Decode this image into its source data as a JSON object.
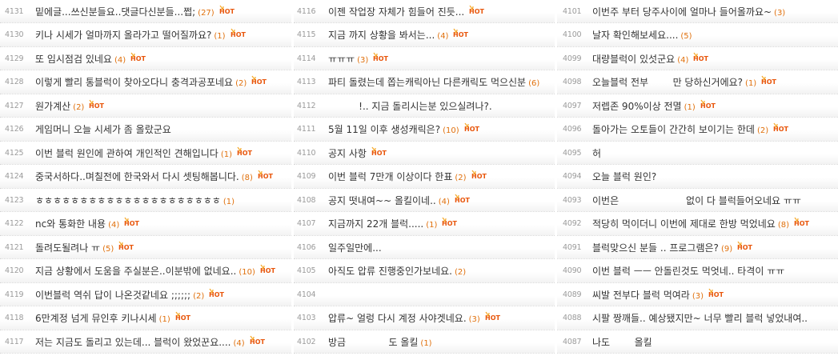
{
  "columns": [
    {
      "rows": [
        {
          "num": "4131",
          "title": "밑에글...쓰신분들요..댓글다신분들...쩝;",
          "count": "(27)",
          "hot": true
        },
        {
          "num": "4130",
          "title": "키나 시세가 얼마까지 올라가고 떨어질까요?",
          "count": "(1)",
          "hot": true
        },
        {
          "num": "4129",
          "title": "또 임시점검 있네요",
          "count": "(4)",
          "hot": true
        },
        {
          "num": "4128",
          "title": "이렇게 빨리 통블럭이 찾아오다니 충격과공포네요",
          "count": "(2)",
          "hot": true
        },
        {
          "num": "4127",
          "title": "원가계산",
          "count": "(2)",
          "hot": true
        },
        {
          "num": "4126",
          "title": "게임머니 오늘 시세가 좀 올랐군요",
          "count": "",
          "hot": false
        },
        {
          "num": "4125",
          "title": "이번 블럭 원인에 관하여 개인적인 견해입니다",
          "count": "(1)",
          "hot": true
        },
        {
          "num": "4124",
          "title": "중국서하다..며칠전에 한국와서 다시 셋팅해봅니다.",
          "count": "(8)",
          "hot": true
        },
        {
          "num": "4123",
          "title": "ㅎㅎㅎㅎㅎㅎㅎㅎㅎㅎㅎㅎㅎㅎㅎㅎㅎㅎㅎㅎㅎ",
          "count": "(1)",
          "hot": false
        },
        {
          "num": "4122",
          "title": "nc와 통화한 내용",
          "count": "(4)",
          "hot": true
        },
        {
          "num": "4121",
          "title": "돌려도될려나 ㅠ",
          "count": "(5)",
          "hot": true
        },
        {
          "num": "4120",
          "title": "지금 상황에서 도움을 주실분은..이분밖에 없네요..",
          "count": "(10)",
          "hot": true
        },
        {
          "num": "4119",
          "title": "이번블럭 역쉬 답이 나온것같네요 ;;;;;;",
          "count": "(2)",
          "hot": true
        },
        {
          "num": "4118",
          "title": "6만계정 넘게 뮤인후 키나시세",
          "count": "(1)",
          "hot": true
        },
        {
          "num": "4117",
          "title": "저는 지금도 돌리고 있는데... 블럭이 왔었꾼요....",
          "count": "(4)",
          "hot": true
        }
      ]
    },
    {
      "rows": [
        {
          "num": "4116",
          "title": "이젠 작업장 자체가 힘들어 진듯...",
          "count": "",
          "hot": true
        },
        {
          "num": "4115",
          "title": "지금 까지 상황을 봐서는...",
          "count": "(4)",
          "hot": true
        },
        {
          "num": "4114",
          "title": "ㅠㅠㅠ",
          "count": "(3)",
          "hot": true
        },
        {
          "num": "4113",
          "title": "파티 돌렸는데 쫍는캐릭아닌 다른캐릭도 먹으신분",
          "count": "(6)",
          "hot": false
        },
        {
          "num": "4112",
          "title": "          !.. 지금 돌리시는분 있으실려나?.",
          "count": "",
          "hot": false
        },
        {
          "num": "4111",
          "title": "5월 11일 이후 생성캐릭은?",
          "count": "(10)",
          "hot": true
        },
        {
          "num": "4110",
          "title": "공지 사항",
          "count": "",
          "hot": true
        },
        {
          "num": "4109",
          "title": "이번 블럭 7만개 이상이다 한표",
          "count": "(2)",
          "hot": true
        },
        {
          "num": "4108",
          "title": "공지 떳내여~~ 올킬이네..",
          "count": "(4)",
          "hot": true
        },
        {
          "num": "4107",
          "title": "지금까지 22개 블럭.....",
          "count": "(1)",
          "hot": true
        },
        {
          "num": "4106",
          "title": "일주일만에...",
          "count": "",
          "hot": false
        },
        {
          "num": "4105",
          "title": "아직도 압류 진행중인가보네요.",
          "count": "(2)",
          "hot": false
        },
        {
          "num": "4104",
          "title": "",
          "count": "",
          "hot": false
        },
        {
          "num": "4103",
          "title": "압류~ 얼렁 다시 계정 사야겟네요.",
          "count": "(3)",
          "hot": true
        },
        {
          "num": "4102",
          "title": "방금              도 올킬",
          "count": "(1)",
          "hot": false
        }
      ]
    },
    {
      "rows": [
        {
          "num": "4101",
          "title": "이번주 부터 당주사이에 얼마나 들어올까요~",
          "count": "(3)",
          "hot": false
        },
        {
          "num": "4100",
          "title": "날자 확인해보세요....",
          "count": "(5)",
          "hot": false
        },
        {
          "num": "4099",
          "title": "대량블럭이 있섯군요",
          "count": "(4)",
          "hot": true
        },
        {
          "num": "4098",
          "title": "오늘블럭 전부        만 당하신거에요?",
          "count": "(1)",
          "hot": true
        },
        {
          "num": "4097",
          "title": "저렙존 90%이상 전멸",
          "count": "(1)",
          "hot": true
        },
        {
          "num": "4096",
          "title": "돌아가는 오토들이 간간히 보이기는 한데",
          "count": "(2)",
          "hot": true
        },
        {
          "num": "4095",
          "title": "허",
          "count": "",
          "hot": false
        },
        {
          "num": "4094",
          "title": "오늘 블럭 원인?",
          "count": "",
          "hot": false
        },
        {
          "num": "4093",
          "title": "이번은                      없이 다 블럭들어오네요 ㅠㅠ",
          "count": "",
          "hot": false
        },
        {
          "num": "4092",
          "title": "적당히 먹이더니 이번에 제대로 한방 먹었네요",
          "count": "(8)",
          "hot": true
        },
        {
          "num": "4091",
          "title": "블럭맞으신 분들 .. 프로그램은?",
          "count": "(9)",
          "hot": true
        },
        {
          "num": "4090",
          "title": "이번 블럭 ㅡㅡ 안돌린것도 먹엇네.. 타격이 ㅠㅠ",
          "count": "",
          "hot": false
        },
        {
          "num": "4089",
          "title": "씨발 전부다 블럭 먹여라",
          "count": "(3)",
          "hot": true
        },
        {
          "num": "4088",
          "title": "시팔 짱깨들.. 예상됐지만~ 너무 빨리 블럭 넣었내여..",
          "count": "",
          "hot": false
        },
        {
          "num": "4087",
          "title": "나도        올킬",
          "count": "",
          "hot": false
        }
      ]
    }
  ],
  "badge": {
    "label": "HOT",
    "color": "#e8560c",
    "flame_color": "#f5a623"
  }
}
